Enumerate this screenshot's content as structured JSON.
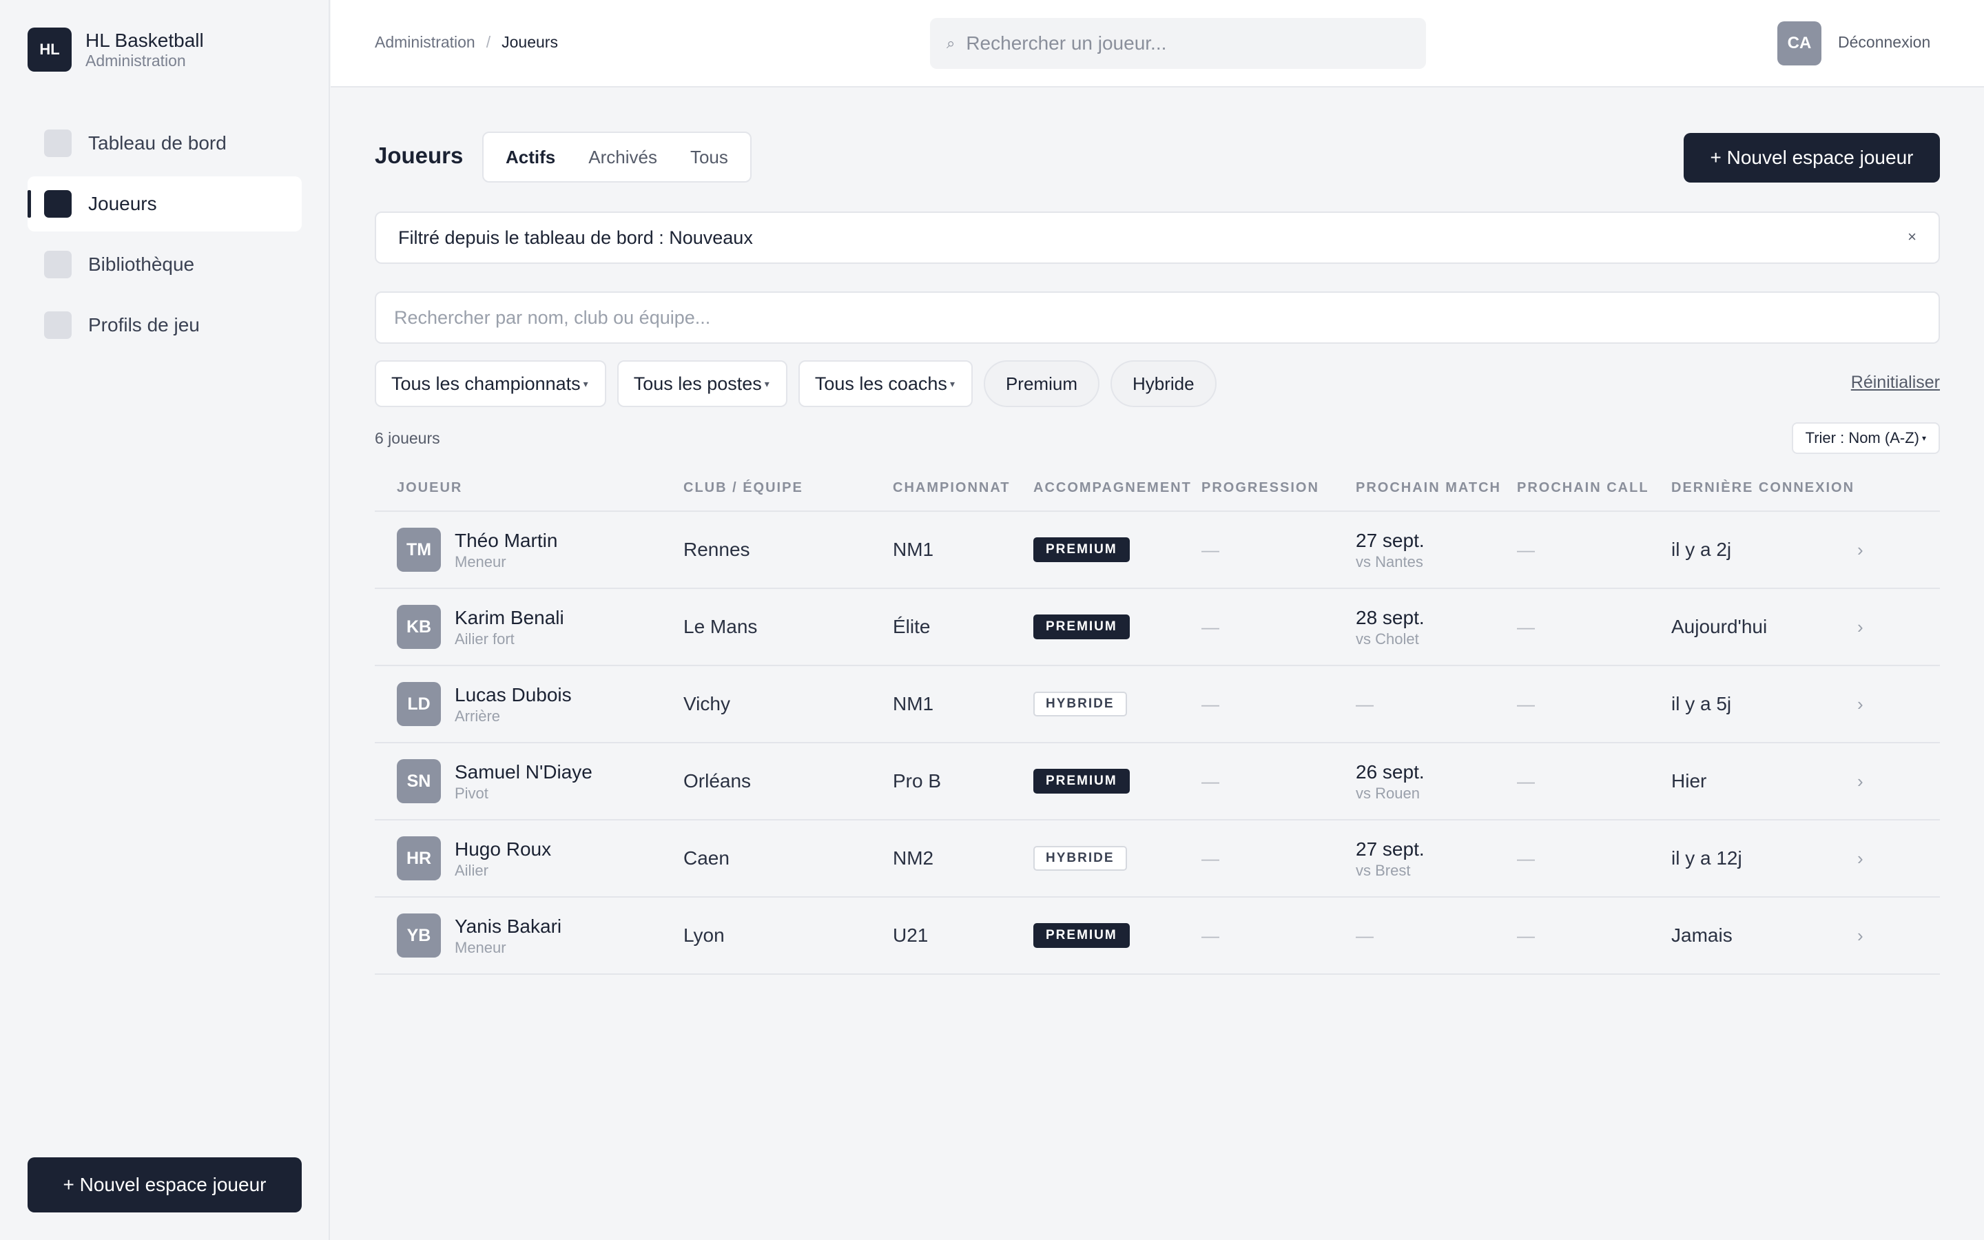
{
  "brand": {
    "logo": "HL",
    "name": "HL Basketball",
    "subtitle": "Administration"
  },
  "sidebar": {
    "items": [
      {
        "label": "Tableau de bord",
        "active": false
      },
      {
        "label": "Joueurs",
        "active": true
      },
      {
        "label": "Bibliothèque",
        "active": false
      },
      {
        "label": "Profils de jeu",
        "active": false
      }
    ],
    "cta": "+ Nouvel espace joueur"
  },
  "header": {
    "breadcrumb": {
      "root": "Administration",
      "separator": "/",
      "current": "Joueurs"
    },
    "search_placeholder": "Rechercher un joueur...",
    "search_icon": "⌕",
    "user_initials": "CA",
    "logout": "Déconnexion"
  },
  "main": {
    "title": "Joueurs",
    "tabs": [
      {
        "label": "Actifs",
        "active": true
      },
      {
        "label": "Archivés",
        "active": false
      },
      {
        "label": "Tous",
        "active": false
      }
    ],
    "cta": "+ Nouvel espace joueur",
    "filter_banner": {
      "text": "Filtré depuis le tableau de bord : Nouveaux",
      "close": "×"
    },
    "table_search_placeholder": "Rechercher par nom, club ou équipe...",
    "filters": {
      "selects": [
        "Tous les championnats",
        "Tous les postes",
        "Tous les coachs"
      ],
      "caret": "▾",
      "chips": [
        "Premium",
        "Hybride"
      ],
      "reset": "Réinitialiser"
    },
    "count": "6 joueurs",
    "sort": "Trier : Nom (A-Z)"
  },
  "table": {
    "columns": [
      "Joueur",
      "Club / Équipe",
      "Championnat",
      "Accompagnement",
      "Progression",
      "Prochain match",
      "Prochain call",
      "Dernière connexion"
    ],
    "dash": "—",
    "chevron": "›",
    "rows": [
      {
        "initials": "TM",
        "name": "Théo Martin",
        "role": "Meneur",
        "club": "Rennes",
        "league": "NM1",
        "plan": "PREMIUM",
        "plan_type": "premium",
        "match_date": "27 sept.",
        "match_opp": "vs Nantes",
        "last_login": "il y a 2j"
      },
      {
        "initials": "KB",
        "name": "Karim Benali",
        "role": "Ailier fort",
        "club": "Le Mans",
        "league": "Élite",
        "plan": "PREMIUM",
        "plan_type": "premium",
        "match_date": "28 sept.",
        "match_opp": "vs Cholet",
        "last_login": "Aujourd'hui"
      },
      {
        "initials": "LD",
        "name": "Lucas Dubois",
        "role": "Arrière",
        "club": "Vichy",
        "league": "NM1",
        "plan": "HYBRIDE",
        "plan_type": "hybride",
        "match_date": "",
        "match_opp": "",
        "last_login": "il y a 5j"
      },
      {
        "initials": "SN",
        "name": "Samuel N'Diaye",
        "role": "Pivot",
        "club": "Orléans",
        "league": "Pro B",
        "plan": "PREMIUM",
        "plan_type": "premium",
        "match_date": "26 sept.",
        "match_opp": "vs Rouen",
        "last_login": "Hier"
      },
      {
        "initials": "HR",
        "name": "Hugo Roux",
        "role": "Ailier",
        "club": "Caen",
        "league": "NM2",
        "plan": "HYBRIDE",
        "plan_type": "hybride",
        "match_date": "27 sept.",
        "match_opp": "vs Brest",
        "last_login": "il y a 12j"
      },
      {
        "initials": "YB",
        "name": "Yanis Bakari",
        "role": "Meneur",
        "club": "Lyon",
        "league": "U21",
        "plan": "PREMIUM",
        "plan_type": "premium",
        "match_date": "",
        "match_opp": "",
        "last_login": "Jamais"
      }
    ]
  }
}
